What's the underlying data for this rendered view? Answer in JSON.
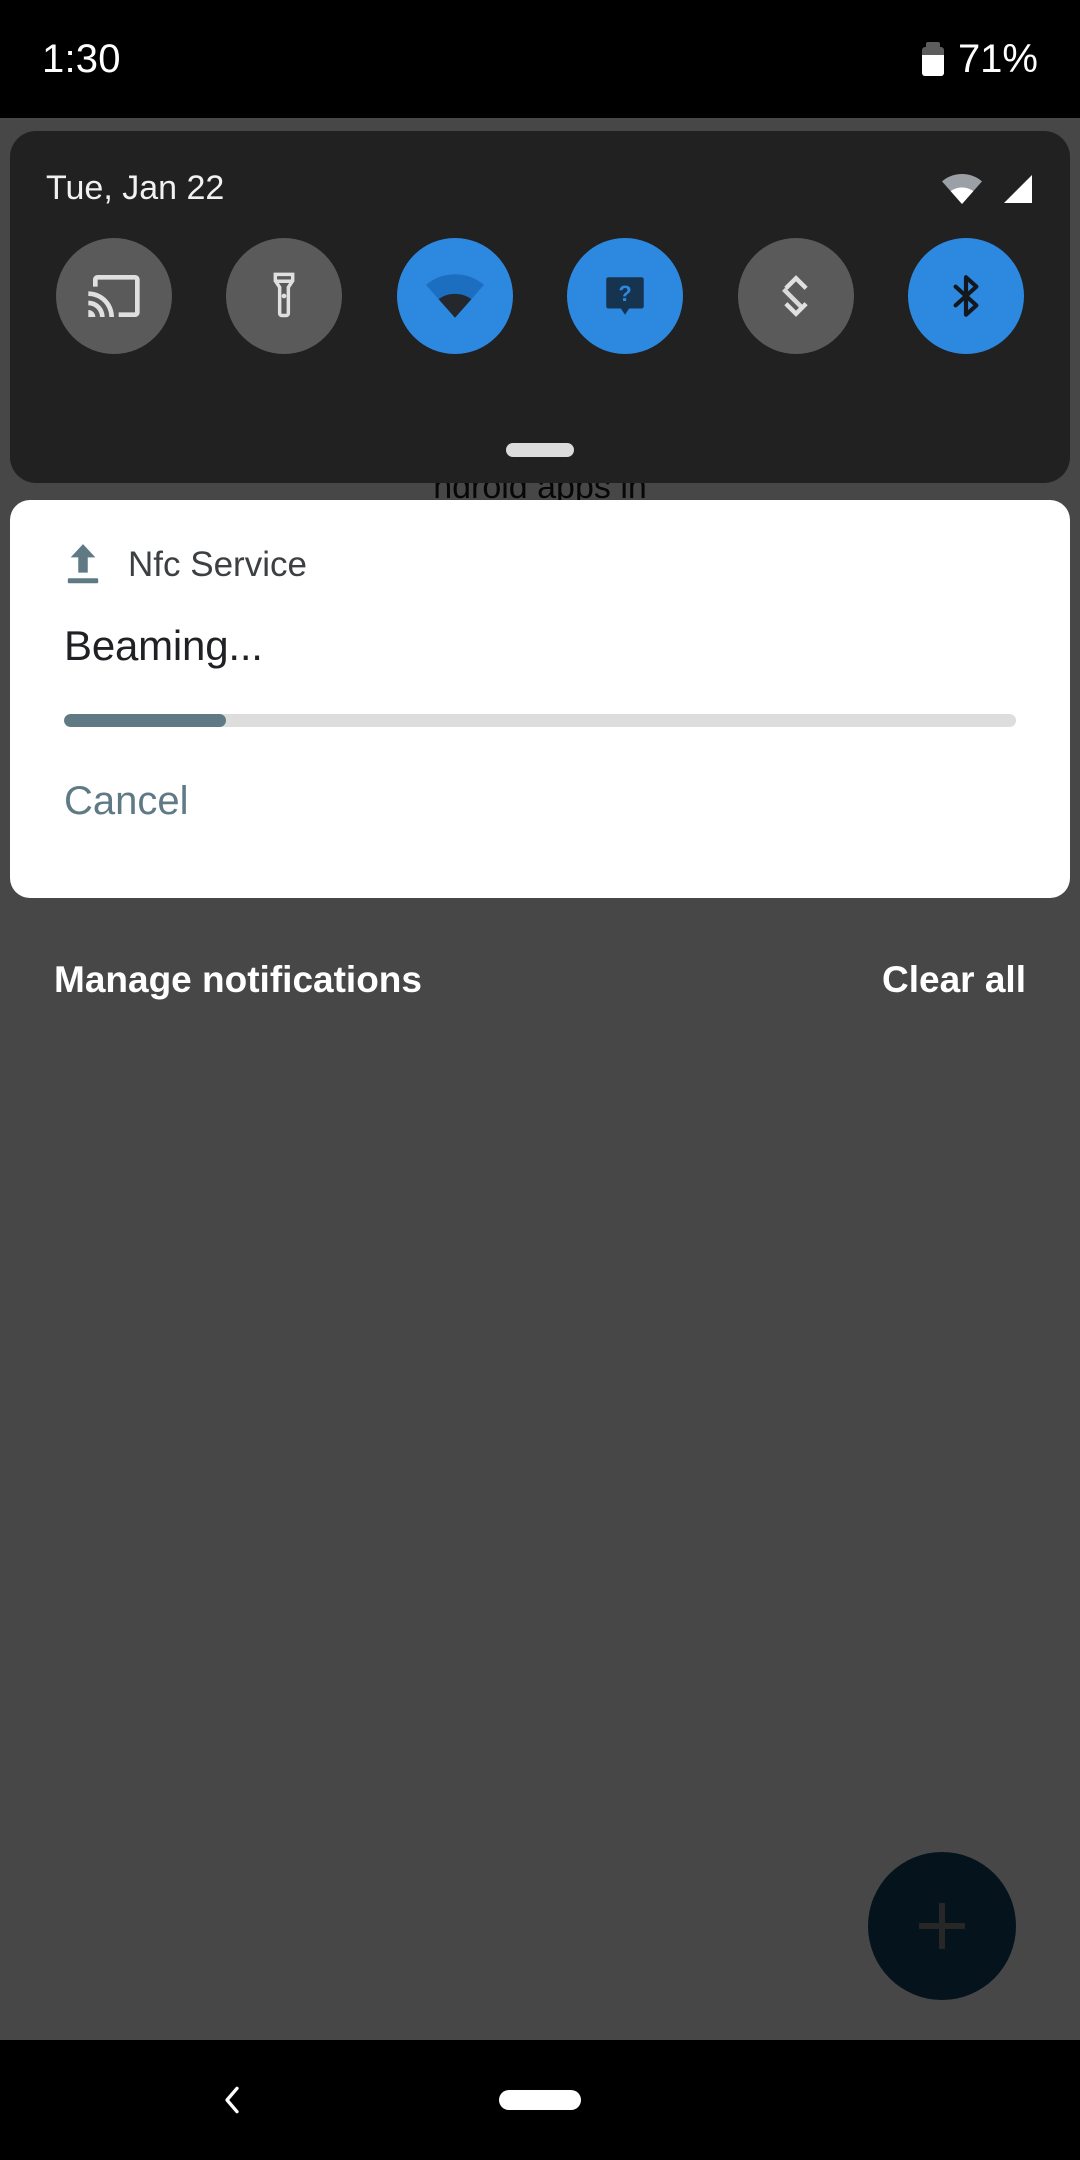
{
  "status_bar": {
    "clock": "1:30",
    "battery_percent": "71%",
    "battery_level": 71,
    "battery_icon": "battery-icon"
  },
  "quick_settings": {
    "date": "Tue, Jan 22",
    "status_icons": [
      {
        "name": "wifi-icon",
        "state": "partial"
      },
      {
        "name": "cell-signal-icon",
        "state": "full"
      }
    ],
    "tiles": [
      {
        "name": "cast-tile",
        "icon": "cast-icon",
        "label": "Cast",
        "active": false
      },
      {
        "name": "flashlight-tile",
        "icon": "flashlight-icon",
        "label": "Flashlight",
        "active": false
      },
      {
        "name": "wifi-tile",
        "icon": "wifi-icon",
        "label": "Wi-Fi",
        "active": true
      },
      {
        "name": "unknown-tile",
        "icon": "question-mark-icon",
        "label": "Unknown",
        "active": true
      },
      {
        "name": "auto-rotate-tile",
        "icon": "auto-rotate-icon",
        "label": "Auto-rotate",
        "active": false
      },
      {
        "name": "bluetooth-tile",
        "icon": "bluetooth-icon",
        "label": "Bluetooth",
        "active": true
      }
    ],
    "drag_handle": "drag-handle"
  },
  "notification": {
    "app_icon": "upload-icon",
    "app_name": "Nfc Service",
    "title": "Beaming...",
    "progress_percent": 17,
    "action_label": "Cancel"
  },
  "shade_footer": {
    "manage_label": "Manage notifications",
    "clear_label": "Clear all"
  },
  "background_app": {
    "occluded_text": "ndroid apps in",
    "fab_icon": "plus-icon"
  },
  "nav_bar": {
    "back": "back-chevron-icon",
    "home": "home-pill-icon"
  },
  "colors": {
    "accent_blue": "#2d88e0",
    "accent_teal": "#5f7a85",
    "panel_dark": "#212121",
    "tile_inactive": "#5a5a5a",
    "card_white": "#ffffff",
    "fab_navy": "#0f4566"
  }
}
